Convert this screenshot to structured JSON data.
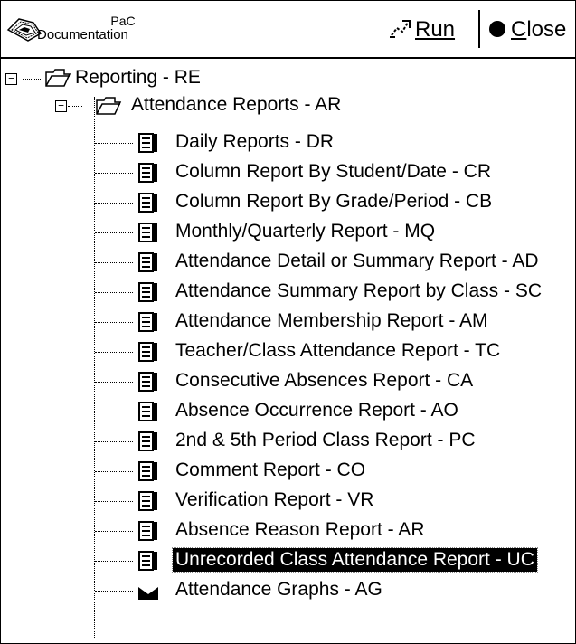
{
  "toolbar": {
    "doc_title_line1": "PaC",
    "doc_title_line2": "Documentation",
    "run_label": "Run",
    "close_label_prefix": "C",
    "close_label_rest": "lose"
  },
  "tree": {
    "root": {
      "label": "Reporting - RE",
      "expanded": true
    },
    "group": {
      "label": "Attendance Reports - AR",
      "expanded": true
    },
    "items": [
      {
        "label": "Daily Reports - DR"
      },
      {
        "label": "Column Report By Student/Date - CR"
      },
      {
        "label": "Column Report By Grade/Period - CB"
      },
      {
        "label": "Monthly/Quarterly Report - MQ"
      },
      {
        "label": "Attendance Detail or Summary Report - AD"
      },
      {
        "label": "Attendance Summary Report by Class - SC"
      },
      {
        "label": "Attendance Membership Report - AM"
      },
      {
        "label": "Teacher/Class Attendance Report - TC"
      },
      {
        "label": "Consecutive Absences Report - CA"
      },
      {
        "label": "Absence Occurrence Report - AO"
      },
      {
        "label": "2nd & 5th Period Class Report - PC"
      },
      {
        "label": "Comment Report - CO"
      },
      {
        "label": "Verification Report - VR"
      },
      {
        "label": "Absence Reason Report - AR"
      },
      {
        "label": "Unrecorded Class Attendance Report - UC",
        "selected": true
      }
    ],
    "partial_item": {
      "label": "Attendance Graphs - AG"
    }
  }
}
